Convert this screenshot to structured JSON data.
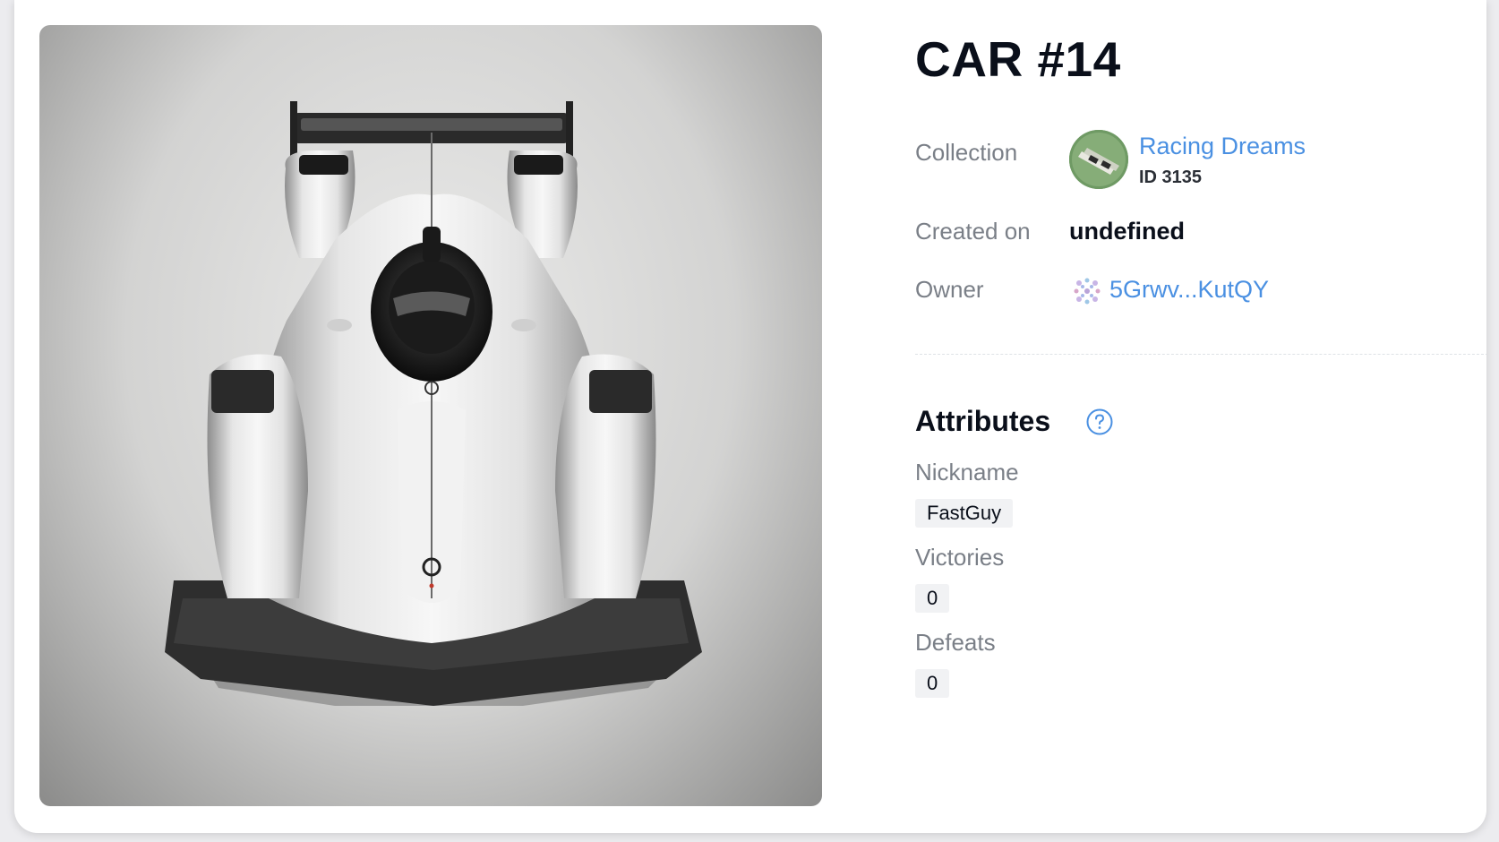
{
  "token": {
    "title": "CAR #14"
  },
  "details": {
    "collection_label": "Collection",
    "collection_name": "Racing Dreams",
    "collection_id": "ID 3135",
    "created_label": "Created on",
    "created_value": "undefined",
    "owner_label": "Owner",
    "owner_address": "5Grwv...KutQY"
  },
  "attributes": {
    "heading": "Attributes",
    "help_icon": "question-circle-icon",
    "items": [
      {
        "name": "Nickname",
        "value": "FastGuy"
      },
      {
        "name": "Victories",
        "value": "0"
      },
      {
        "name": "Defeats",
        "value": "0"
      }
    ]
  },
  "colors": {
    "link": "#4a90e2",
    "label": "#7a7f87",
    "text": "#0a0f1a",
    "chip_bg": "#f1f2f4"
  }
}
